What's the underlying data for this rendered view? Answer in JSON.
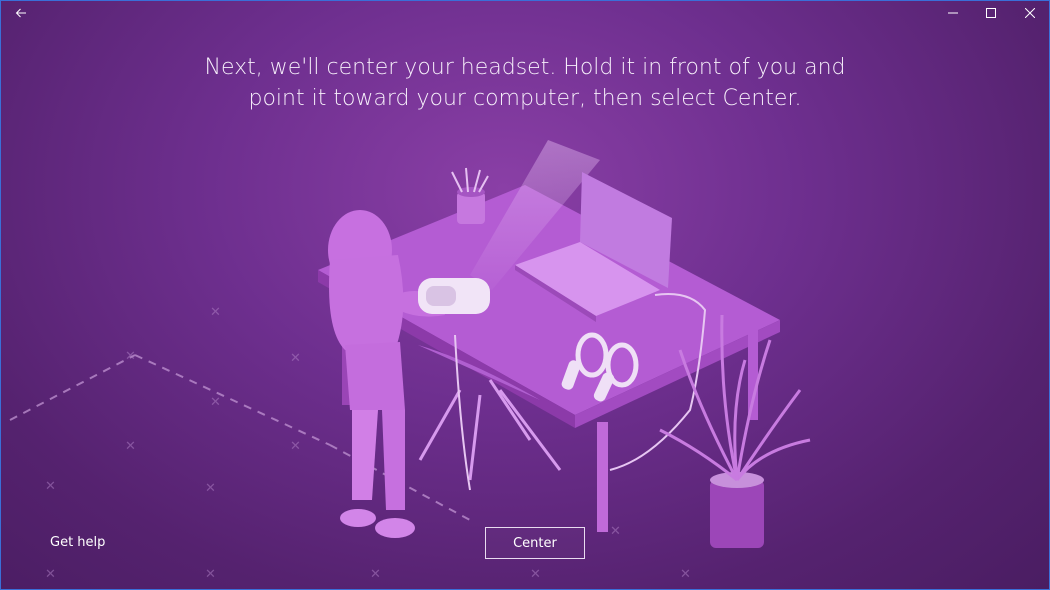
{
  "window": {
    "back_icon": "arrow-left-icon",
    "minimize_icon": "minimize-icon",
    "maximize_icon": "maximize-icon",
    "close_icon": "close-icon"
  },
  "instruction": {
    "line1": "Next, we'll center your headset. Hold it in front of you and",
    "line2": "point it toward your computer, then select Center."
  },
  "footer": {
    "help_label": "Get help",
    "center_label": "Center"
  },
  "colors": {
    "background": "#6e2f8f",
    "accent": "#d77be8",
    "border": "#3a6fd8"
  }
}
